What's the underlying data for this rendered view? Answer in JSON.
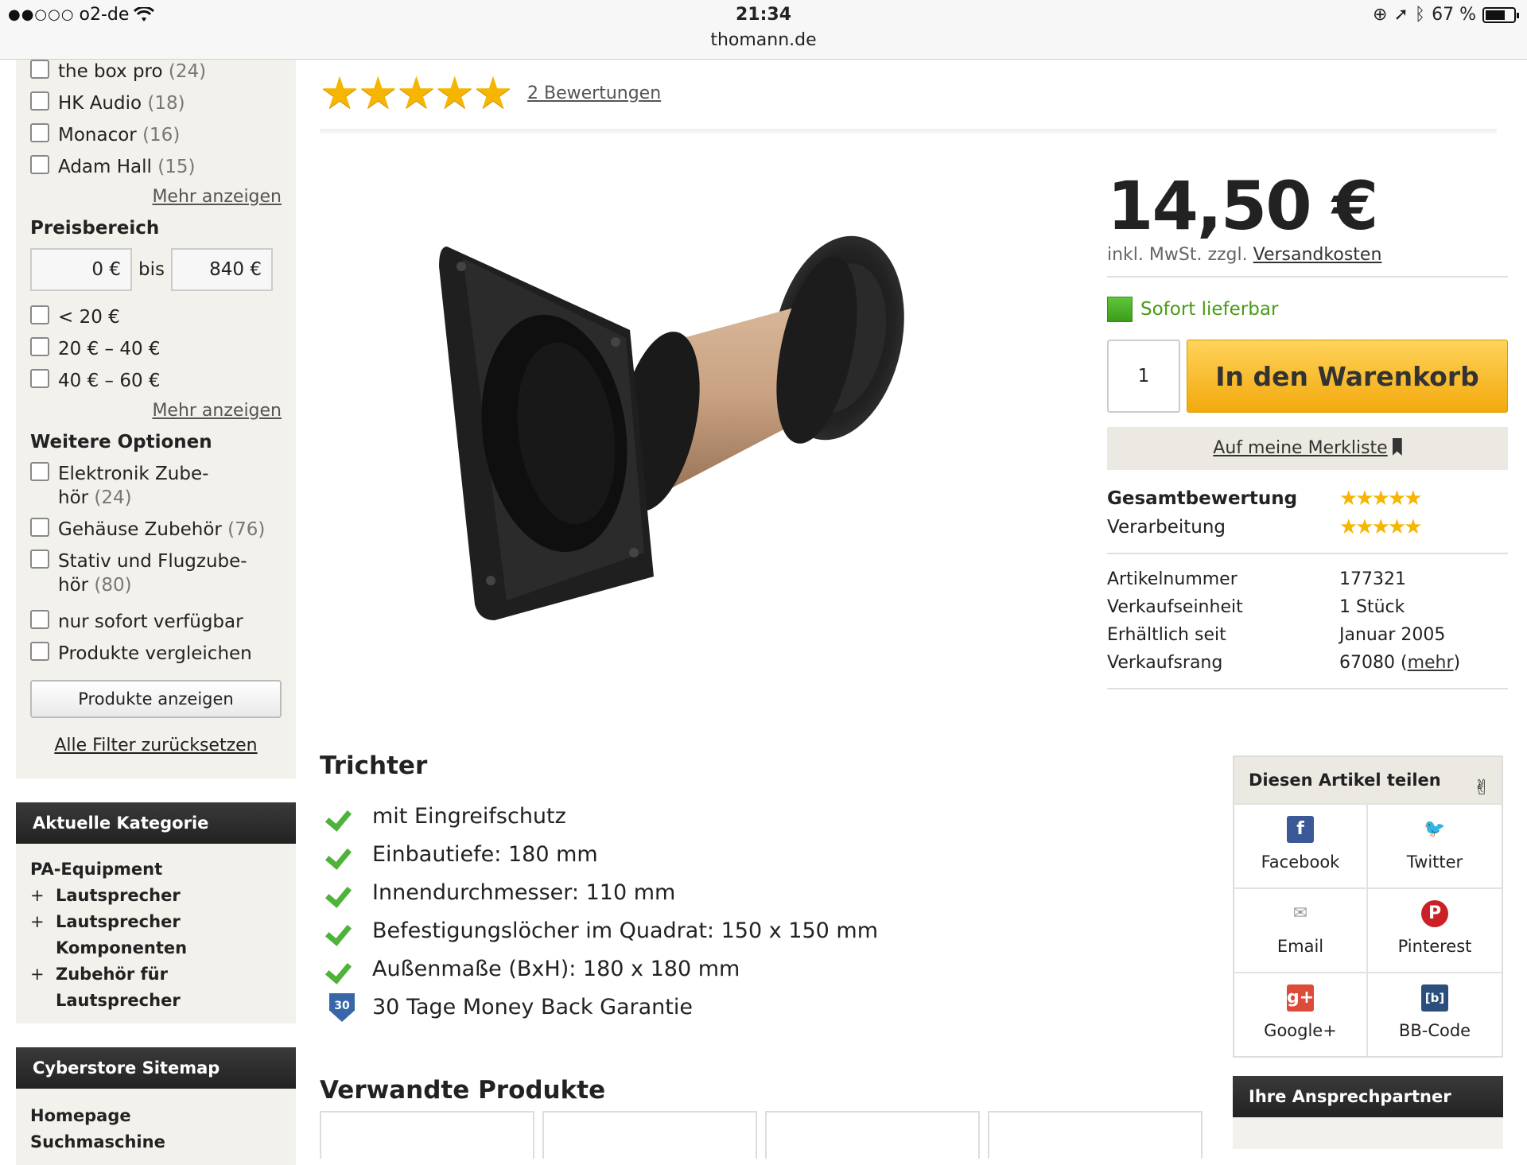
{
  "status_bar": {
    "carrier_dots": "●●○○○",
    "carrier": "o2-de",
    "time": "21:34",
    "url": "thomann.de",
    "battery": "67 %",
    "battery_level": 0.67
  },
  "sidebar": {
    "brands": [
      {
        "name": "the box pro",
        "count": "(24)"
      },
      {
        "name": "HK Audio",
        "count": "(18)"
      },
      {
        "name": "Monacor",
        "count": "(16)"
      },
      {
        "name": "Adam Hall",
        "count": "(15)"
      }
    ],
    "more_label": "Mehr anzeigen",
    "price_heading": "Preisbereich",
    "price_min": "0 €",
    "price_to": "bis",
    "price_max": "840 €",
    "price_ranges": [
      "< 20 €",
      "20 € – 40 €",
      "40 € – 60 €"
    ],
    "options_heading": "Weitere Optionen",
    "options": [
      {
        "name": "Elektronik Zube-",
        "name2": "hör",
        "count": "(24)"
      },
      {
        "name": "Gehäuse Zubehör",
        "count": "(76)"
      },
      {
        "name": "Stativ und Flugzube-",
        "name2": "hör",
        "count": "(80)"
      },
      {
        "name": "nur sofort verfügbar",
        "count": ""
      },
      {
        "name": "Produkte vergleichen",
        "count": ""
      }
    ],
    "show_button": "Produkte anzeigen",
    "reset_label": "Alle Filter zurücksetzen",
    "category_heading": "Aktuelle Kategorie",
    "category_root": "PA-Equipment",
    "category_items": [
      "Lautsprecher",
      "Lautsprecher Komponenten",
      "Zubehör für Lautsprecher"
    ],
    "sitemap_heading": "Cyberstore Sitemap",
    "sitemap_items": [
      "Homepage",
      "Suchmaschine"
    ]
  },
  "product": {
    "stars": "★★★★★",
    "reviews_link": "2 Bewertungen",
    "price": "14,50 €",
    "tax_note": "inkl. MwSt. zzgl.",
    "shipping_link": "Versandkosten",
    "availability": "Sofort lieferbar",
    "quantity": "1",
    "cart_button": "In den Warenkorb",
    "wishlist_button": "Auf meine Merkliste",
    "ratings": [
      {
        "label": "Gesamtbewertung",
        "stars": "★★★★★",
        "value": 5
      },
      {
        "label": "Verarbeitung",
        "stars": "★★★★★",
        "value": 4.5
      }
    ],
    "info": [
      {
        "label": "Artikelnummer",
        "value": "177321"
      },
      {
        "label": "Verkaufseinheit",
        "value": "1 Stück"
      },
      {
        "label": "Erhältlich seit",
        "value": "Januar 2005"
      },
      {
        "label": "Verkaufsrang",
        "value": "67080",
        "link": "mehr"
      }
    ],
    "title": "Trichter",
    "features": [
      "mit Eingreifschutz",
      "Einbautiefe: 180 mm",
      "Innendurchmesser: 110 mm",
      "Befestigungslöcher im Quadrat: 150 x 150 mm",
      "Außenmaße (BxH): 180 x 180 mm"
    ],
    "guarantee_badge": "30",
    "guarantee": "30 Tage Money Back Garantie",
    "related_heading": "Verwandte Produkte"
  },
  "share": {
    "heading": "Diesen Artikel teilen",
    "items": [
      {
        "label": "Facebook",
        "icon": "facebook-icon",
        "glyph": "f",
        "color": "#3b5998"
      },
      {
        "label": "Twitter",
        "icon": "twitter-icon",
        "glyph": "🐦",
        "color": "#1da1f2"
      },
      {
        "label": "Email",
        "icon": "email-icon",
        "glyph": "✉",
        "color": "#999999"
      },
      {
        "label": "Pinterest",
        "icon": "pinterest-icon",
        "glyph": "P",
        "color": "#cb2027"
      },
      {
        "label": "Google+",
        "icon": "googleplus-icon",
        "glyph": "g+",
        "color": "#dd4b39"
      },
      {
        "label": "BB-Code",
        "icon": "bbcode-icon",
        "glyph": "[b]",
        "color": "#2b4f7a"
      }
    ]
  },
  "contact": {
    "heading": "Ihre Ansprechpartner"
  }
}
